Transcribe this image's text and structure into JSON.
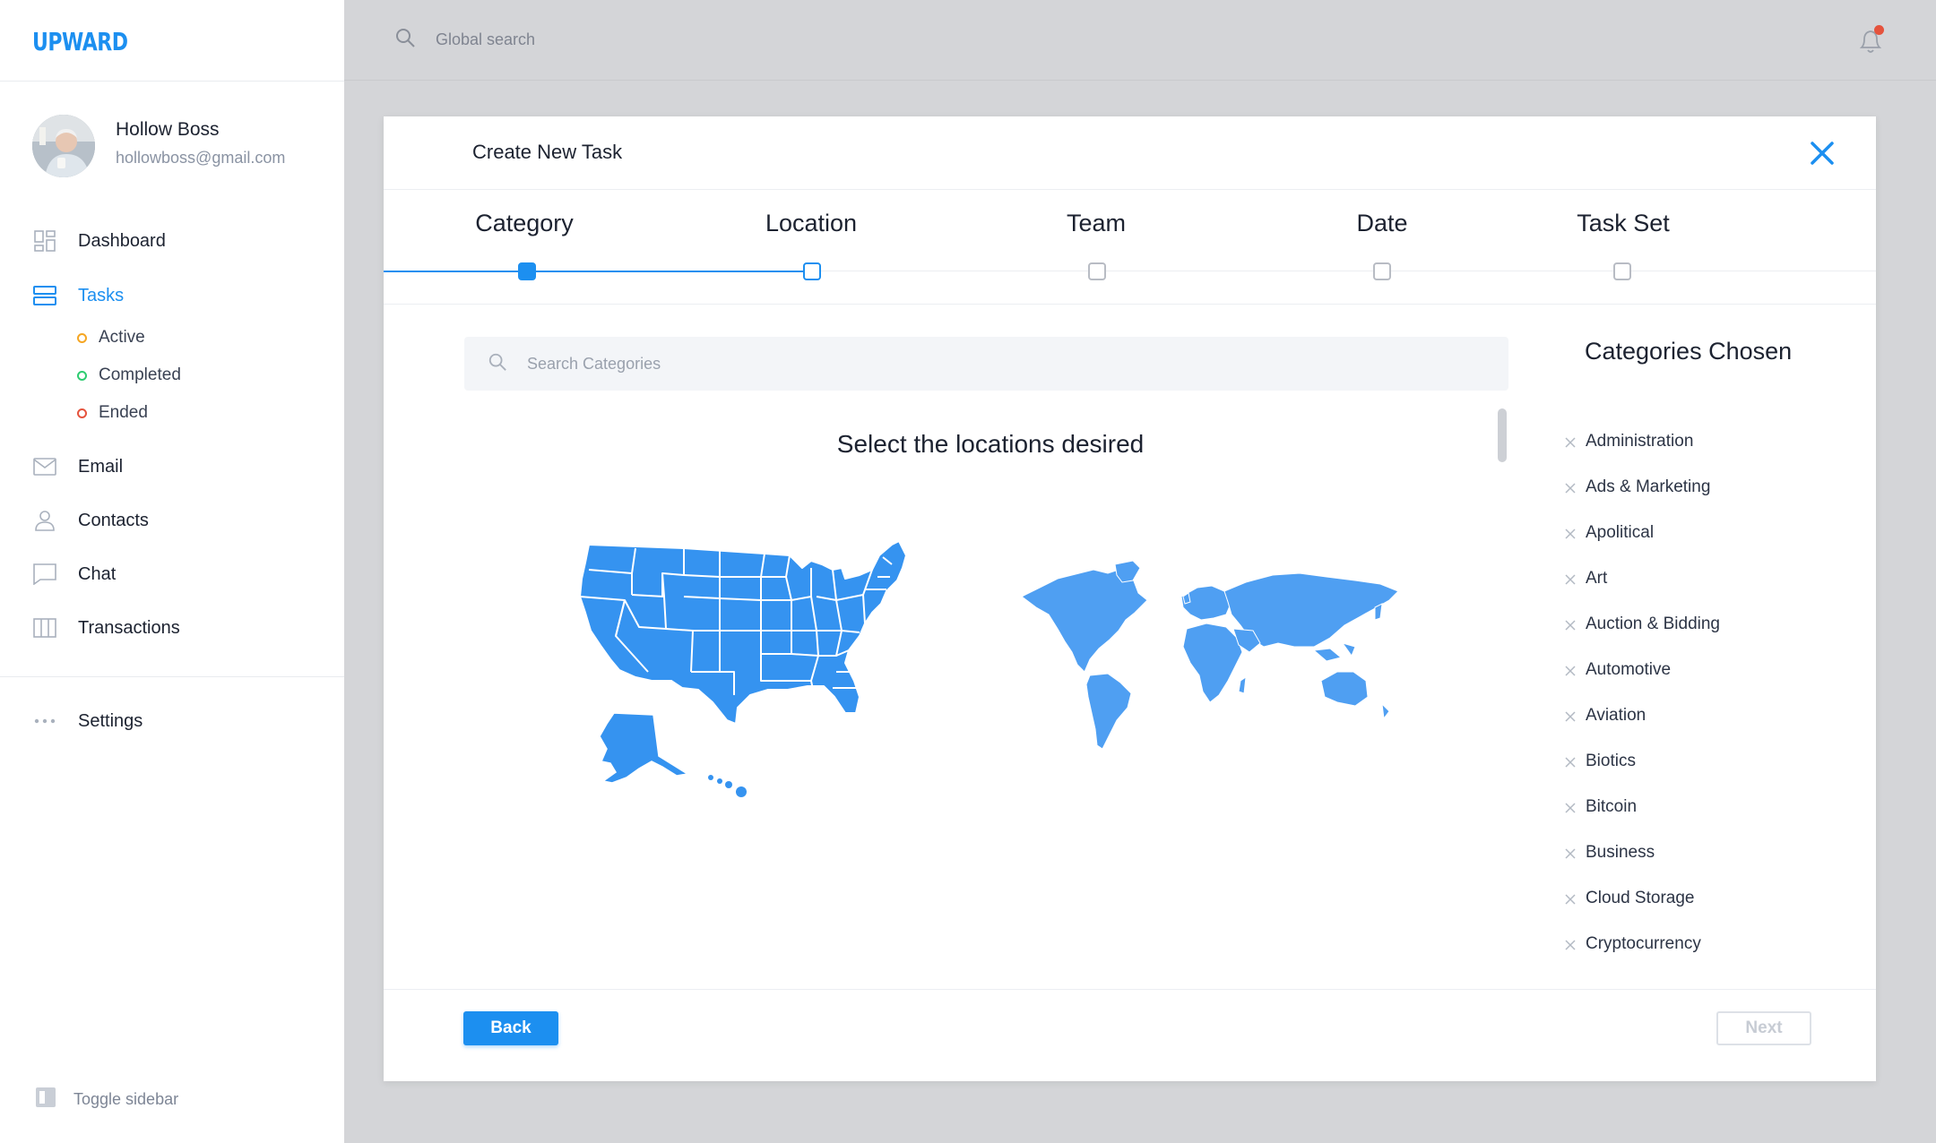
{
  "app": {
    "logo": "UPWARD"
  },
  "user": {
    "name": "Hollow Boss",
    "email": "hollowboss@gmail.com"
  },
  "nav": {
    "dashboard": "Dashboard",
    "tasks": "Tasks",
    "tasks_sub": {
      "active": "Active",
      "completed": "Completed",
      "ended": "Ended"
    },
    "email": "Email",
    "contacts": "Contacts",
    "chat": "Chat",
    "transactions": "Transactions",
    "settings": "Settings",
    "toggle_sidebar": "Toggle sidebar"
  },
  "colors": {
    "accent": "#1c8ff0",
    "active_dot": "#f5a623",
    "completed_dot": "#2ecc71",
    "ended_dot": "#e5533d"
  },
  "topbar": {
    "search_placeholder": "Global search",
    "notification_badge": true
  },
  "modal": {
    "title": "Create New Task",
    "steps": [
      "Category",
      "Location",
      "Team",
      "Date",
      "Task Set"
    ],
    "current_step": 1,
    "search_placeholder": "Search Categories",
    "heading": "Select the locations desired",
    "chosen_title": "Categories Chosen",
    "chosen": [
      "Administration",
      "Ads & Marketing",
      "Apolitical",
      "Art",
      "Auction & Bidding",
      "Automotive",
      "Aviation",
      "Biotics",
      "Bitcoin",
      "Business",
      "Cloud Storage",
      "Cryptocurrency"
    ],
    "back": "Back",
    "next": "Next"
  }
}
